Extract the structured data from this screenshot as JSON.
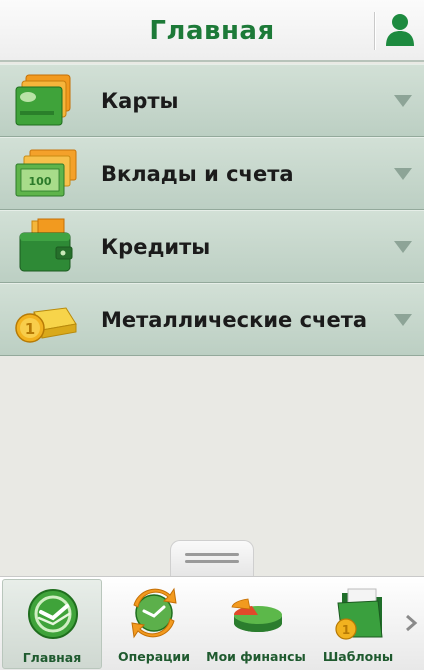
{
  "header": {
    "title": "Главная"
  },
  "menu": {
    "items": [
      {
        "label": "Карты"
      },
      {
        "label": "Вклады и счета"
      },
      {
        "label": "Кредиты"
      },
      {
        "label": "Металлические счета"
      }
    ]
  },
  "bottom_nav": {
    "items": [
      {
        "label": "Главная",
        "active": true
      },
      {
        "label": "Операции"
      },
      {
        "label": "Мои финансы"
      },
      {
        "label": "Шаблоны"
      }
    ]
  },
  "colors": {
    "brand_green": "#1d7a38",
    "menu_bg": "#c8d9ce",
    "bottom_label": "#1f5a2f"
  }
}
